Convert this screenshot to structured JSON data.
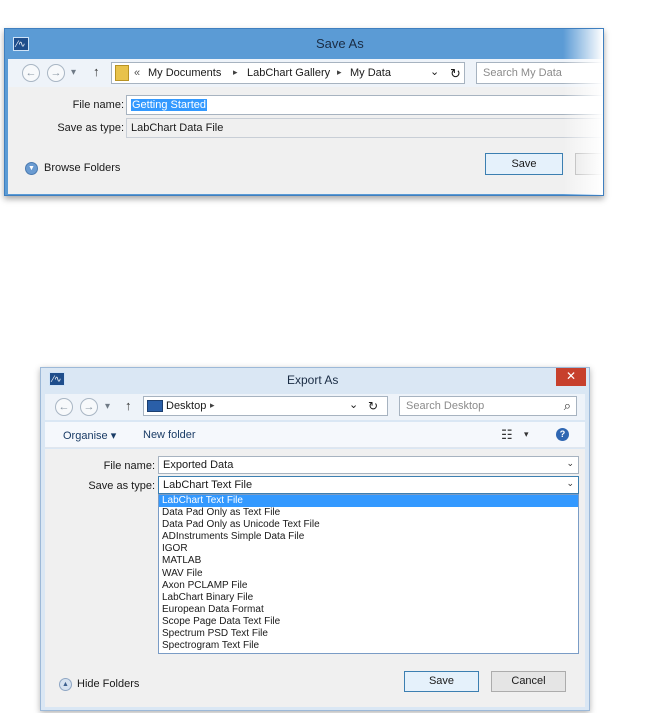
{
  "save_dialog": {
    "title": "Save As",
    "nav": {
      "back": "←",
      "forward": "→",
      "recent": "▾",
      "up": "↑"
    },
    "breadcrumb": {
      "overflow": "«",
      "items": [
        "My Documents",
        "LabChart Gallery",
        "My Data"
      ],
      "separator": "▸"
    },
    "address_dropdown": "⌄",
    "refresh": "↻",
    "search_placeholder": "Search My Data",
    "file_name_label": "File name:",
    "file_name_value": "Getting Started",
    "save_as_type_label": "Save as type:",
    "save_as_type_value": "LabChart Data File",
    "browse_folders_label": "Browse Folders",
    "save_button": "Save"
  },
  "export_dialog": {
    "title": "Export As",
    "close": "✕",
    "nav": {
      "back": "←",
      "forward": "→",
      "recent": "▾",
      "up": "↑"
    },
    "location": "Desktop",
    "location_arrow": "▸",
    "address_dropdown": "⌄",
    "refresh": "↻",
    "search_placeholder": "Search Desktop",
    "search_icon": "⌕",
    "organise_label": "Organise ▾",
    "new_folder_label": "New folder",
    "view_icon": "☷",
    "view_arrow": "▾",
    "help_icon": "?",
    "file_name_label": "File name:",
    "file_name_value": "Exported Data",
    "save_as_type_label": "Save as type:",
    "save_as_type_value": "LabChart Text File",
    "type_options": [
      "LabChart Text File",
      "Data Pad Only as Text File",
      "Data Pad Only as Unicode Text File",
      "ADInstruments Simple Data File",
      "IGOR",
      "MATLAB",
      "WAV File",
      "Axon PCLAMP File",
      "LabChart Binary File",
      "European Data Format",
      "Scope Page Data Text File",
      "Spectrum PSD Text File",
      "Spectrogram Text File"
    ],
    "hide_folders_label": "Hide Folders",
    "save_button": "Save",
    "cancel_button": "Cancel"
  },
  "colors": {
    "title_bar_blue": "#5b9bd5",
    "selection_blue": "#3399ff",
    "close_red": "#c7402c"
  }
}
